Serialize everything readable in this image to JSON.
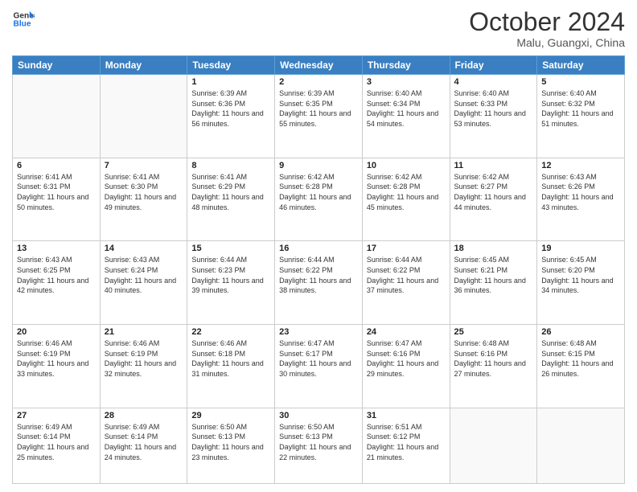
{
  "header": {
    "logo_line1": "General",
    "logo_line2": "Blue",
    "month": "October 2024",
    "location": "Malu, Guangxi, China"
  },
  "weekdays": [
    "Sunday",
    "Monday",
    "Tuesday",
    "Wednesday",
    "Thursday",
    "Friday",
    "Saturday"
  ],
  "weeks": [
    [
      {
        "day": "",
        "sunrise": "",
        "sunset": "",
        "daylight": ""
      },
      {
        "day": "",
        "sunrise": "",
        "sunset": "",
        "daylight": ""
      },
      {
        "day": "1",
        "sunrise": "Sunrise: 6:39 AM",
        "sunset": "Sunset: 6:36 PM",
        "daylight": "Daylight: 11 hours and 56 minutes."
      },
      {
        "day": "2",
        "sunrise": "Sunrise: 6:39 AM",
        "sunset": "Sunset: 6:35 PM",
        "daylight": "Daylight: 11 hours and 55 minutes."
      },
      {
        "day": "3",
        "sunrise": "Sunrise: 6:40 AM",
        "sunset": "Sunset: 6:34 PM",
        "daylight": "Daylight: 11 hours and 54 minutes."
      },
      {
        "day": "4",
        "sunrise": "Sunrise: 6:40 AM",
        "sunset": "Sunset: 6:33 PM",
        "daylight": "Daylight: 11 hours and 53 minutes."
      },
      {
        "day": "5",
        "sunrise": "Sunrise: 6:40 AM",
        "sunset": "Sunset: 6:32 PM",
        "daylight": "Daylight: 11 hours and 51 minutes."
      }
    ],
    [
      {
        "day": "6",
        "sunrise": "Sunrise: 6:41 AM",
        "sunset": "Sunset: 6:31 PM",
        "daylight": "Daylight: 11 hours and 50 minutes."
      },
      {
        "day": "7",
        "sunrise": "Sunrise: 6:41 AM",
        "sunset": "Sunset: 6:30 PM",
        "daylight": "Daylight: 11 hours and 49 minutes."
      },
      {
        "day": "8",
        "sunrise": "Sunrise: 6:41 AM",
        "sunset": "Sunset: 6:29 PM",
        "daylight": "Daylight: 11 hours and 48 minutes."
      },
      {
        "day": "9",
        "sunrise": "Sunrise: 6:42 AM",
        "sunset": "Sunset: 6:28 PM",
        "daylight": "Daylight: 11 hours and 46 minutes."
      },
      {
        "day": "10",
        "sunrise": "Sunrise: 6:42 AM",
        "sunset": "Sunset: 6:28 PM",
        "daylight": "Daylight: 11 hours and 45 minutes."
      },
      {
        "day": "11",
        "sunrise": "Sunrise: 6:42 AM",
        "sunset": "Sunset: 6:27 PM",
        "daylight": "Daylight: 11 hours and 44 minutes."
      },
      {
        "day": "12",
        "sunrise": "Sunrise: 6:43 AM",
        "sunset": "Sunset: 6:26 PM",
        "daylight": "Daylight: 11 hours and 43 minutes."
      }
    ],
    [
      {
        "day": "13",
        "sunrise": "Sunrise: 6:43 AM",
        "sunset": "Sunset: 6:25 PM",
        "daylight": "Daylight: 11 hours and 42 minutes."
      },
      {
        "day": "14",
        "sunrise": "Sunrise: 6:43 AM",
        "sunset": "Sunset: 6:24 PM",
        "daylight": "Daylight: 11 hours and 40 minutes."
      },
      {
        "day": "15",
        "sunrise": "Sunrise: 6:44 AM",
        "sunset": "Sunset: 6:23 PM",
        "daylight": "Daylight: 11 hours and 39 minutes."
      },
      {
        "day": "16",
        "sunrise": "Sunrise: 6:44 AM",
        "sunset": "Sunset: 6:22 PM",
        "daylight": "Daylight: 11 hours and 38 minutes."
      },
      {
        "day": "17",
        "sunrise": "Sunrise: 6:44 AM",
        "sunset": "Sunset: 6:22 PM",
        "daylight": "Daylight: 11 hours and 37 minutes."
      },
      {
        "day": "18",
        "sunrise": "Sunrise: 6:45 AM",
        "sunset": "Sunset: 6:21 PM",
        "daylight": "Daylight: 11 hours and 36 minutes."
      },
      {
        "day": "19",
        "sunrise": "Sunrise: 6:45 AM",
        "sunset": "Sunset: 6:20 PM",
        "daylight": "Daylight: 11 hours and 34 minutes."
      }
    ],
    [
      {
        "day": "20",
        "sunrise": "Sunrise: 6:46 AM",
        "sunset": "Sunset: 6:19 PM",
        "daylight": "Daylight: 11 hours and 33 minutes."
      },
      {
        "day": "21",
        "sunrise": "Sunrise: 6:46 AM",
        "sunset": "Sunset: 6:19 PM",
        "daylight": "Daylight: 11 hours and 32 minutes."
      },
      {
        "day": "22",
        "sunrise": "Sunrise: 6:46 AM",
        "sunset": "Sunset: 6:18 PM",
        "daylight": "Daylight: 11 hours and 31 minutes."
      },
      {
        "day": "23",
        "sunrise": "Sunrise: 6:47 AM",
        "sunset": "Sunset: 6:17 PM",
        "daylight": "Daylight: 11 hours and 30 minutes."
      },
      {
        "day": "24",
        "sunrise": "Sunrise: 6:47 AM",
        "sunset": "Sunset: 6:16 PM",
        "daylight": "Daylight: 11 hours and 29 minutes."
      },
      {
        "day": "25",
        "sunrise": "Sunrise: 6:48 AM",
        "sunset": "Sunset: 6:16 PM",
        "daylight": "Daylight: 11 hours and 27 minutes."
      },
      {
        "day": "26",
        "sunrise": "Sunrise: 6:48 AM",
        "sunset": "Sunset: 6:15 PM",
        "daylight": "Daylight: 11 hours and 26 minutes."
      }
    ],
    [
      {
        "day": "27",
        "sunrise": "Sunrise: 6:49 AM",
        "sunset": "Sunset: 6:14 PM",
        "daylight": "Daylight: 11 hours and 25 minutes."
      },
      {
        "day": "28",
        "sunrise": "Sunrise: 6:49 AM",
        "sunset": "Sunset: 6:14 PM",
        "daylight": "Daylight: 11 hours and 24 minutes."
      },
      {
        "day": "29",
        "sunrise": "Sunrise: 6:50 AM",
        "sunset": "Sunset: 6:13 PM",
        "daylight": "Daylight: 11 hours and 23 minutes."
      },
      {
        "day": "30",
        "sunrise": "Sunrise: 6:50 AM",
        "sunset": "Sunset: 6:13 PM",
        "daylight": "Daylight: 11 hours and 22 minutes."
      },
      {
        "day": "31",
        "sunrise": "Sunrise: 6:51 AM",
        "sunset": "Sunset: 6:12 PM",
        "daylight": "Daylight: 11 hours and 21 minutes."
      },
      {
        "day": "",
        "sunrise": "",
        "sunset": "",
        "daylight": ""
      },
      {
        "day": "",
        "sunrise": "",
        "sunset": "",
        "daylight": ""
      }
    ]
  ]
}
